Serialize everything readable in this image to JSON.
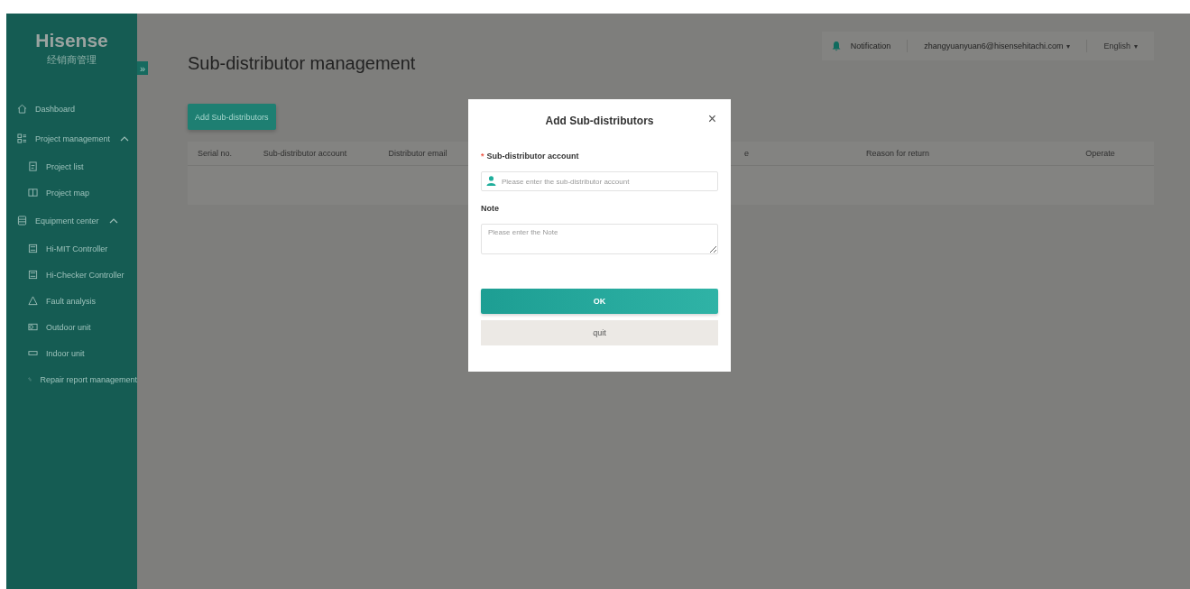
{
  "sidebar": {
    "logo": "Hisense",
    "subtitle": "经销商管理",
    "collapse_toggle": "»",
    "items": [
      {
        "label": "Dashboard"
      },
      {
        "label": "Project management",
        "expanded": true,
        "children": [
          {
            "label": "Project list"
          },
          {
            "label": "Project map"
          }
        ]
      },
      {
        "label": "Equipment center",
        "expanded": true,
        "children": [
          {
            "label": "Hi-MIT Controller"
          },
          {
            "label": "Hi-Checker Controller"
          },
          {
            "label": "Fault analysis"
          },
          {
            "label": "Outdoor unit"
          },
          {
            "label": "Indoor unit"
          },
          {
            "label": "Repair report management"
          }
        ]
      }
    ]
  },
  "header": {
    "notification": "Notification",
    "user": "zhangyuanyuan6@hisensehitachi.com",
    "user_caret": "▾",
    "language": "English",
    "language_caret": "▾"
  },
  "page_title": "Sub-distributor management",
  "add_button": "Add Sub-distributors",
  "table": {
    "columns": [
      "Serial no.",
      "Sub-distributor account",
      "Distributor email",
      "e",
      "Reason for return",
      "Operate"
    ]
  },
  "dialog": {
    "title": "Add Sub-distributors",
    "close": "×",
    "fields": [
      {
        "label": "Sub-distributor account",
        "required": true,
        "kind": "input",
        "placeholder": "Please enter the sub-distributor account"
      },
      {
        "label": "Note",
        "required": false,
        "kind": "textarea",
        "placeholder": "Please enter the Note"
      }
    ],
    "required_mark": "*",
    "ok": "OK",
    "quit": "quit"
  }
}
